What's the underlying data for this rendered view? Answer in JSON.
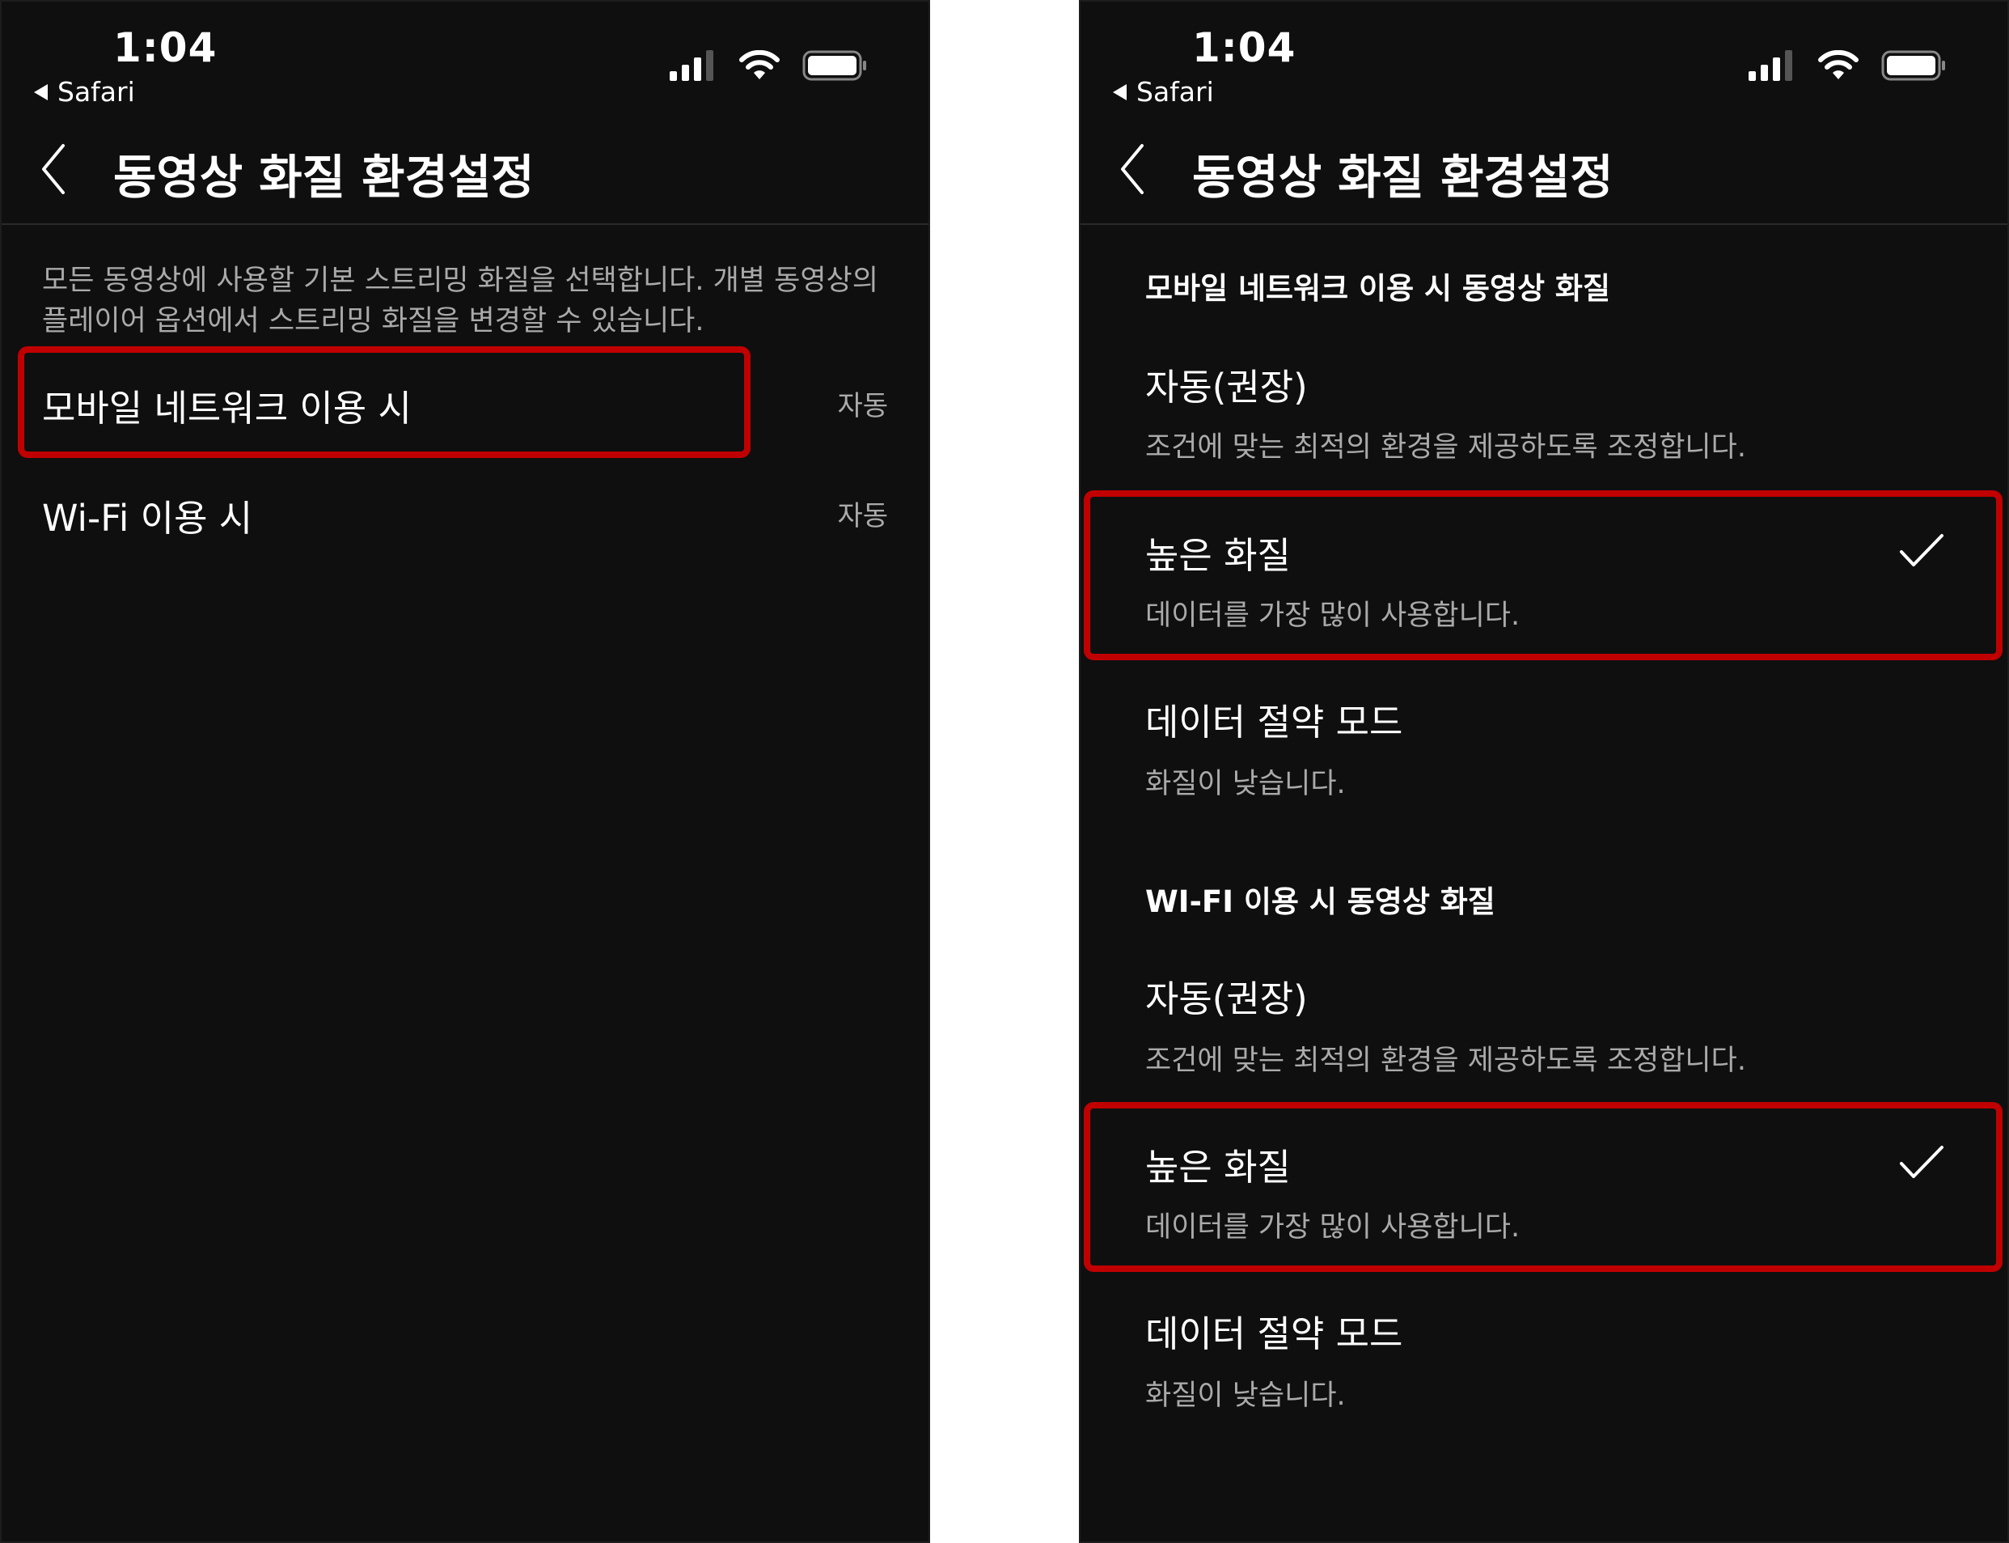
{
  "status": {
    "time": "1:04",
    "back_app": "Safari",
    "icons": [
      "signal-icon",
      "wifi-icon",
      "battery-icon"
    ]
  },
  "header": {
    "title": "동영상 화질 환경설정"
  },
  "left": {
    "description": "모든 동영상에 사용할 기본 스트리밍 화질을 선택합니다. 개별 동영상의 플레이어 옵션에서 스트리밍 화질을 변경할 수 있습니다.",
    "rows": [
      {
        "label": "모바일 네트워크 이용 시",
        "value": "자동",
        "highlighted": true
      },
      {
        "label": "Wi-Fi 이용 시",
        "value": "자동",
        "highlighted": false
      }
    ]
  },
  "right": {
    "sections": [
      {
        "title": "모바일 네트워크 이용 시 동영상 화질",
        "options": [
          {
            "title": "자동(권장)",
            "desc": "조건에 맞는 최적의 환경을 제공하도록 조정합니다.",
            "selected": false
          },
          {
            "title": "높은 화질",
            "desc": "데이터를 가장 많이 사용합니다.",
            "selected": true
          },
          {
            "title": "데이터 절약 모드",
            "desc": "화질이 낮습니다.",
            "selected": false
          }
        ]
      },
      {
        "title": "WI-FI 이용 시 동영상 화질",
        "options": [
          {
            "title": "자동(권장)",
            "desc": "조건에 맞는 최적의 환경을 제공하도록 조정합니다.",
            "selected": false
          },
          {
            "title": "높은 화질",
            "desc": "데이터를 가장 많이 사용합니다.",
            "selected": true
          },
          {
            "title": "데이터 절약 모드",
            "desc": "화질이 낮습니다.",
            "selected": false
          }
        ]
      }
    ]
  },
  "colors": {
    "background": "#0f0f0f",
    "text": "#ffffff",
    "secondary_text": "#aaaaaa",
    "highlight_box": "#c00000"
  }
}
